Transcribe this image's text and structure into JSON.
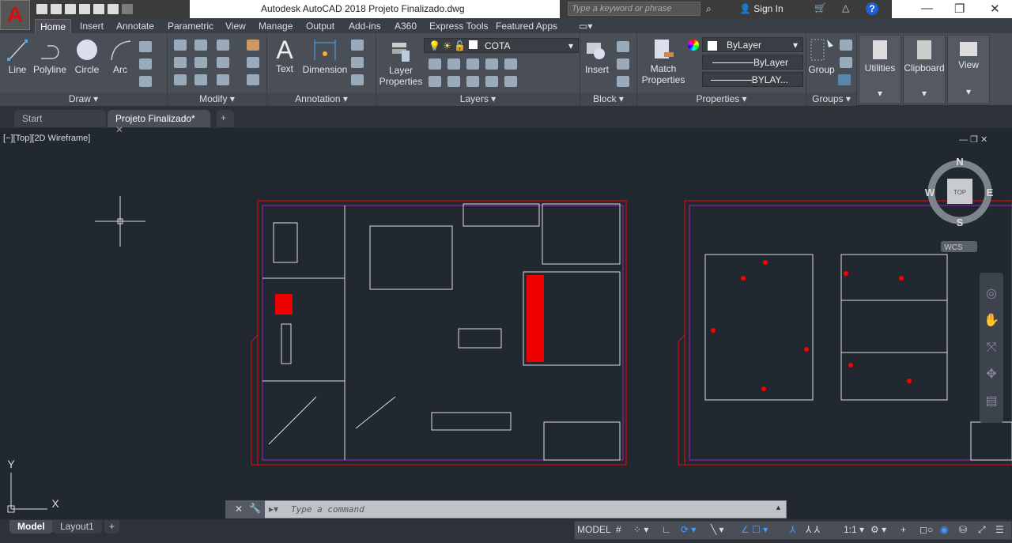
{
  "title": "Autodesk AutoCAD 2018    Projeto Finalizado.dwg",
  "app_button": "A",
  "search": {
    "placeholder": "Type a keyword or phrase"
  },
  "sign_in": "Sign In",
  "ribbon_tabs": [
    "Home",
    "Insert",
    "Annotate",
    "Parametric",
    "View",
    "Manage",
    "Output",
    "Add-ins",
    "A360",
    "Express Tools",
    "Featured Apps"
  ],
  "panels": {
    "draw": {
      "label": "Draw",
      "buttons": [
        "Line",
        "Polyline",
        "Circle",
        "Arc"
      ]
    },
    "modify": {
      "label": "Modify"
    },
    "annotation": {
      "label": "Annotation",
      "buttons": [
        "Text",
        "Dimension"
      ]
    },
    "layers": {
      "label": "Layers",
      "button": "Layer Properties",
      "layer": "COTA"
    },
    "block": {
      "label": "Block",
      "button": "Insert"
    },
    "properties": {
      "label": "Properties",
      "button": "Match Properties",
      "color": "ByLayer",
      "linetype": "ByLayer",
      "lineweight": "BYLAY..."
    },
    "groups": {
      "label": "Groups",
      "button": "Group"
    },
    "utilities": "Utilities",
    "clipboard": "Clipboard",
    "view": "View"
  },
  "file_tabs": [
    "Start",
    "Projeto Finalizado*"
  ],
  "viewport_label": "[−][Top][2D Wireframe]",
  "viewcube": {
    "n": "N",
    "s": "S",
    "e": "E",
    "w": "W",
    "face": "TOP",
    "ucs": "WCS"
  },
  "ucs": {
    "x": "X",
    "y": "Y"
  },
  "command": {
    "placeholder": "Type a command"
  },
  "layout_tabs": [
    "Model",
    "Layout1"
  ],
  "status": {
    "model": "MODEL",
    "scale": "1:1"
  },
  "colors": {
    "accent": "#c8102e",
    "drawing_red": "#ff0000",
    "layout_purple": "#a020c0"
  }
}
